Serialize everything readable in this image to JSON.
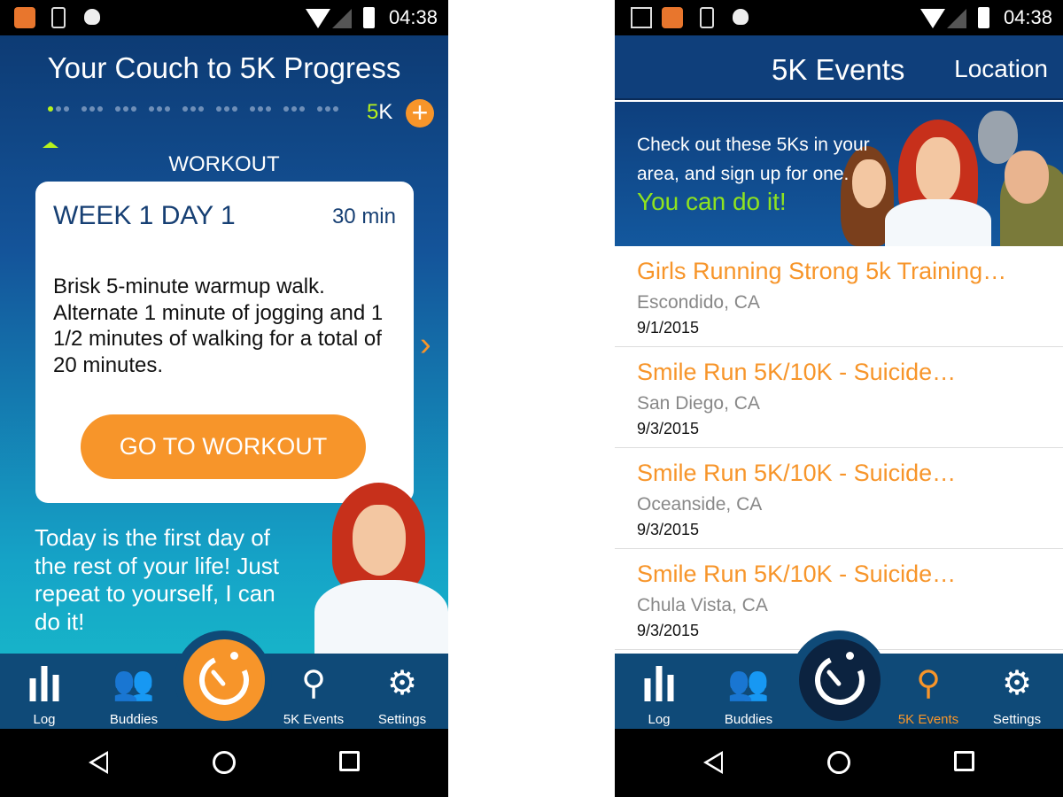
{
  "status": {
    "time": "04:38"
  },
  "progress": {
    "title": "Your Couch to 5K Progress",
    "goal_prefix": "5",
    "goal_suffix": "K",
    "section": "WORKOUT",
    "workout": {
      "title": "WEEK 1 DAY 1",
      "duration": "30 min",
      "description": "Brisk 5-minute warmup walk. Alternate 1 minute of jogging and 1 1/2 minutes of walking for a total of 20 minutes.",
      "button": "GO TO WORKOUT"
    },
    "motivation": "Today is the first day of the rest of your life! Just repeat to yourself, I can do it!",
    "completed_days": 1,
    "total_days": 27
  },
  "events": {
    "title": "5K Events",
    "location": "Location",
    "banner_text": "Check out these 5Ks in your area, and sign up for one.",
    "banner_cta": "You can do it!",
    "items": [
      {
        "name": "Girls Running Strong 5k Training…",
        "city": "Escondido, CA",
        "date": "9/1/2015"
      },
      {
        "name": "Smile Run 5K/10K - Suicide…",
        "city": "San Diego, CA",
        "date": "9/3/2015"
      },
      {
        "name": "Smile Run 5K/10K - Suicide…",
        "city": "Oceanside, CA",
        "date": "9/3/2015"
      },
      {
        "name": "Smile Run 5K/10K - Suicide…",
        "city": "Chula Vista, CA",
        "date": "9/3/2015"
      }
    ]
  },
  "nav": {
    "log": "Log",
    "buddies": "Buddies",
    "events": "5K Events",
    "settings": "Settings"
  },
  "colors": {
    "accent": "#f7952a",
    "lime": "#b6f21c",
    "navy": "#0f4a78"
  }
}
